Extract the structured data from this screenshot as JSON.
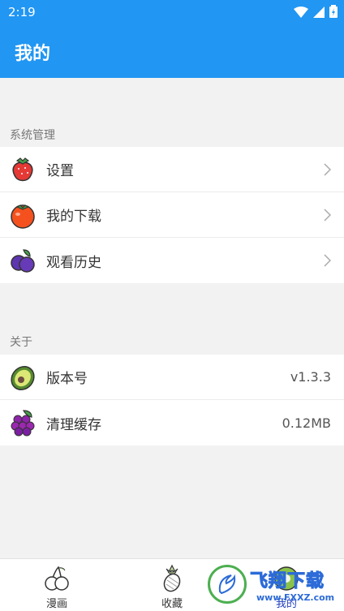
{
  "status": {
    "time": "2:19"
  },
  "app": {
    "title": "我的"
  },
  "sections": {
    "system": {
      "header": "系统管理",
      "items": [
        {
          "label": "设置",
          "icon": "strawberry-icon"
        },
        {
          "label": "我的下载",
          "icon": "tomato-icon"
        },
        {
          "label": "观看历史",
          "icon": "blueberry-icon"
        }
      ]
    },
    "about": {
      "header": "关于",
      "items": [
        {
          "label": "版本号",
          "value": "v1.3.3",
          "icon": "avocado-icon"
        },
        {
          "label": "清理缓存",
          "value": "0.12MB",
          "icon": "grape-icon"
        }
      ]
    }
  },
  "nav": {
    "items": [
      {
        "label": "漫画",
        "icon": "cherry-icon"
      },
      {
        "label": "收藏",
        "icon": "pineapple-icon"
      },
      {
        "label": "我的",
        "icon": "kiwi-icon"
      }
    ],
    "active": "我的"
  },
  "watermark": {
    "title": "飞翔下载",
    "subtitle": "www.FXXZ.com"
  },
  "colors": {
    "primary": "#2196f3",
    "active_nav": "#1f3dbd"
  }
}
